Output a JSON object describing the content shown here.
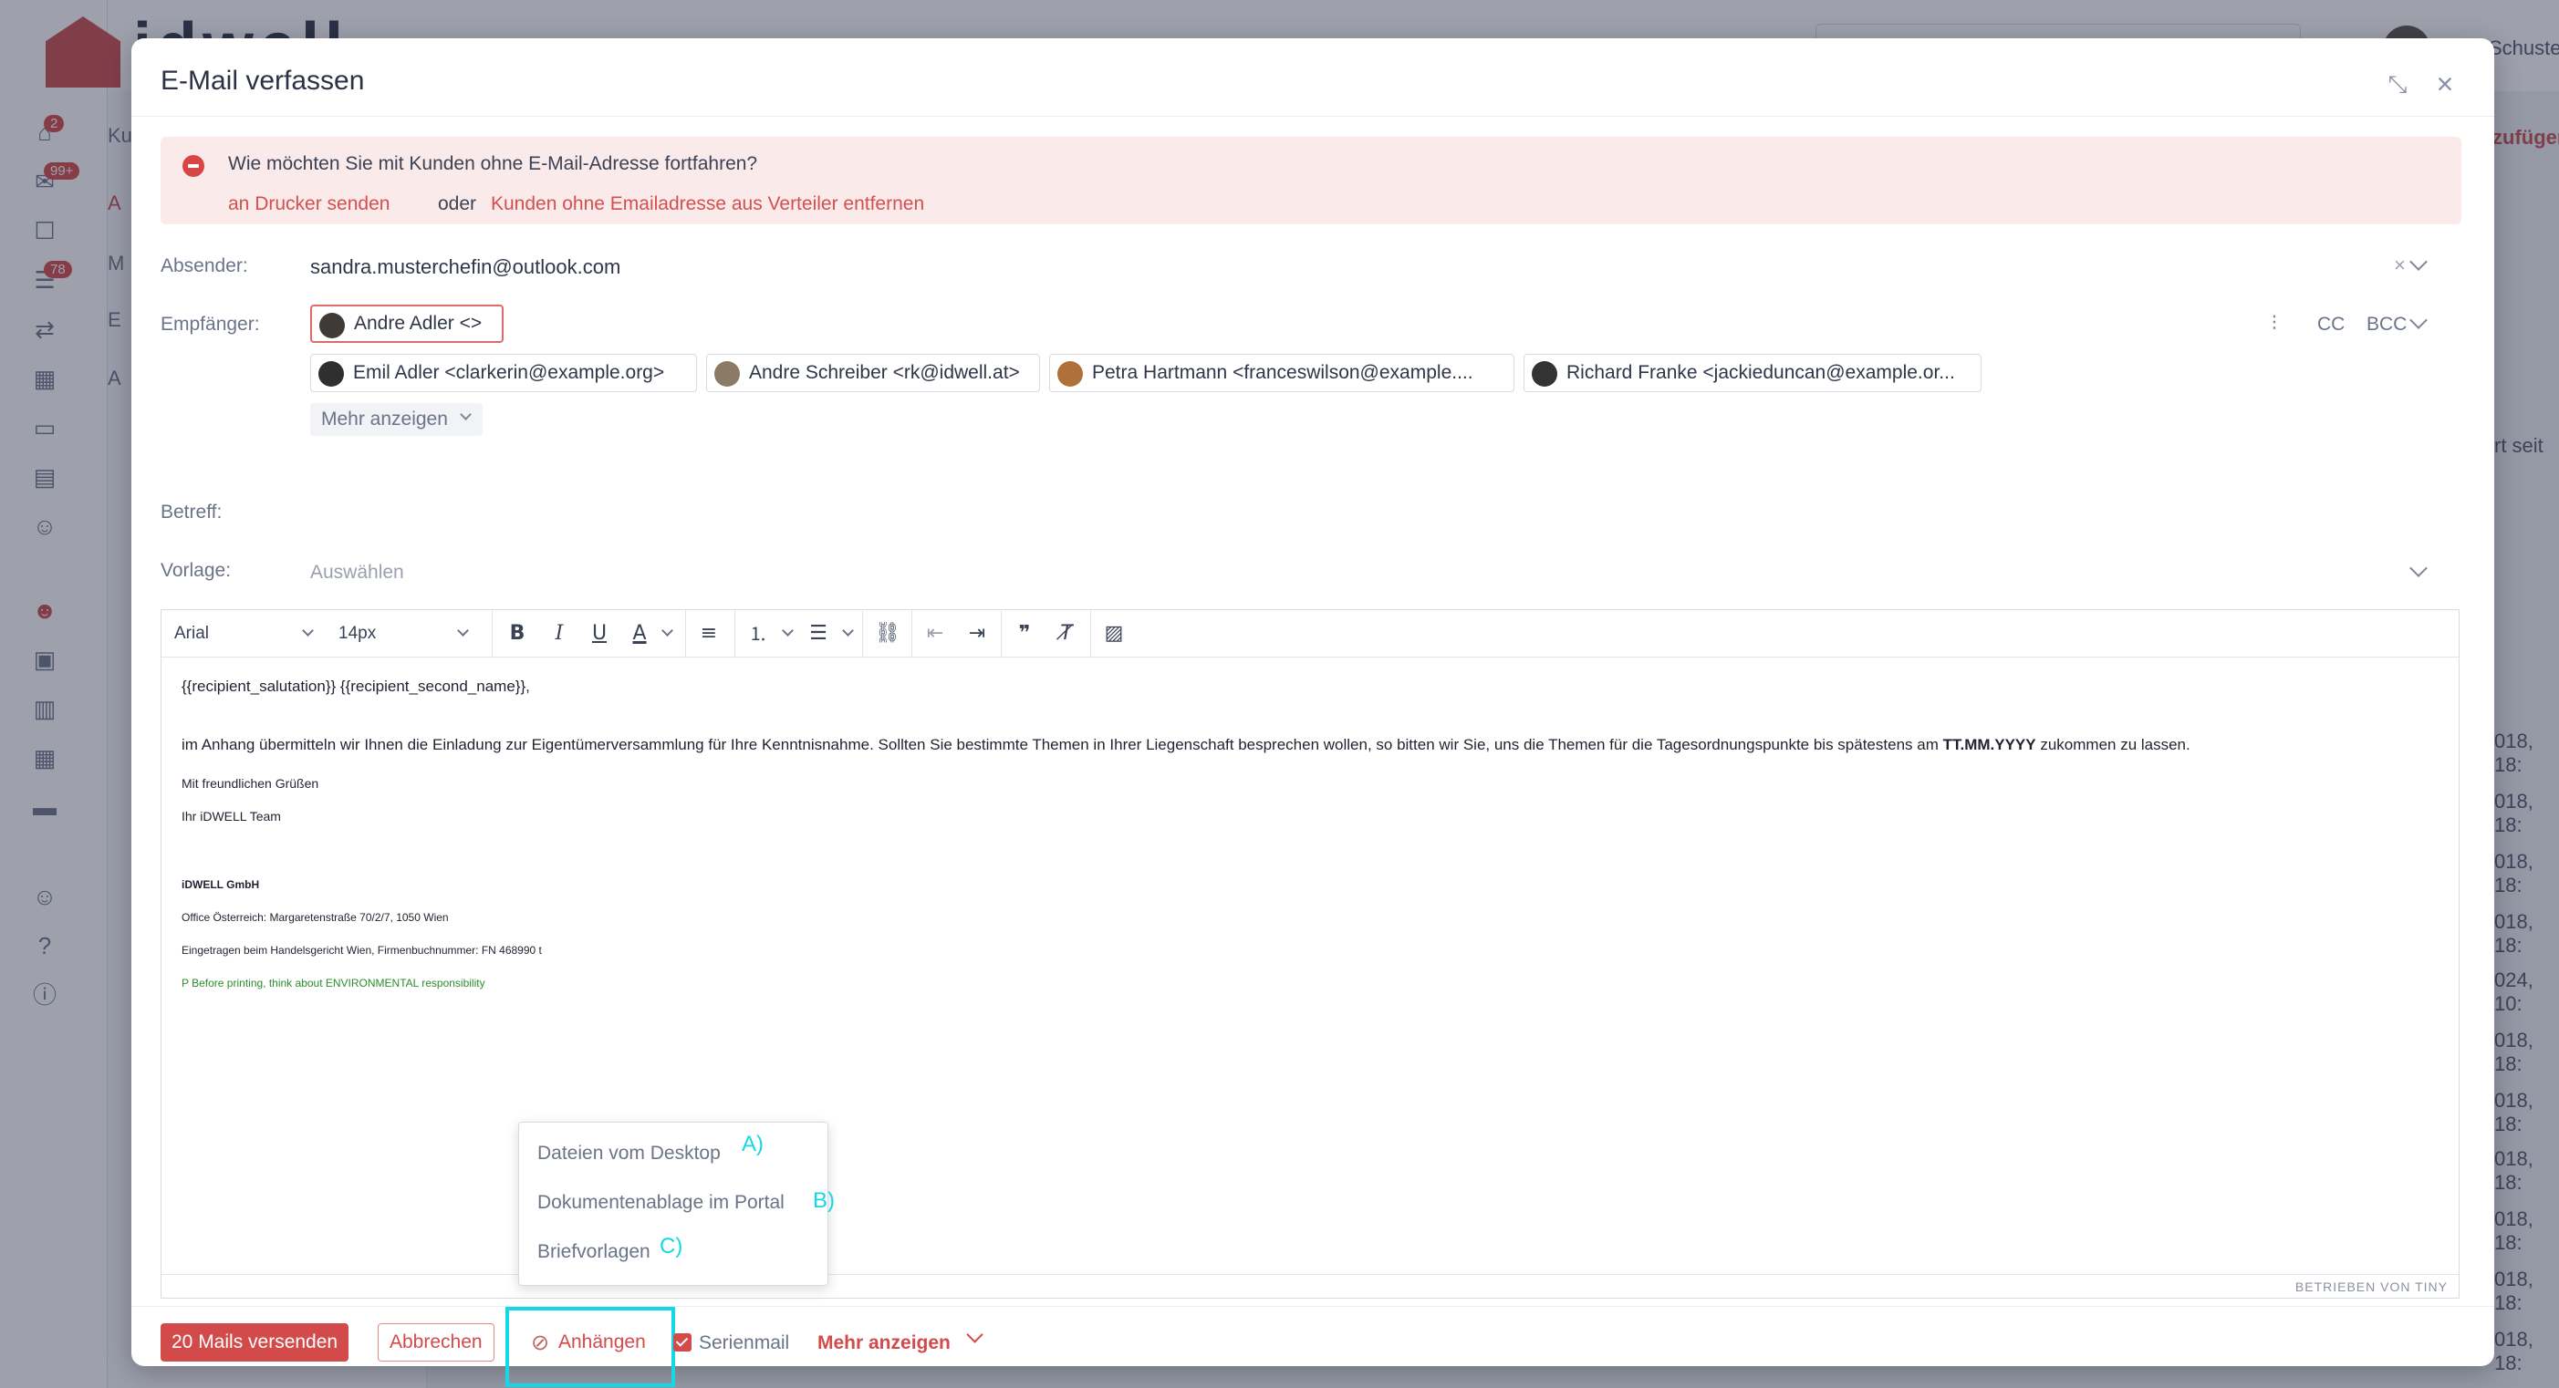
{
  "background": {
    "logo_text": "idwell",
    "nav_badges": [
      "2",
      "99+",
      "78"
    ],
    "subnav_letters": [
      "Ku",
      "A",
      "M",
      "E",
      "A"
    ],
    "username": "Schuster",
    "add_button": "zufügen",
    "table_label": "rt seit",
    "row_dates": [
      "018, 18:",
      "018, 18:",
      "018, 18:",
      "018, 18:",
      "024, 10:",
      "018, 18:",
      "018, 18:",
      "018, 18:",
      "018, 18:",
      "018, 18:",
      "018, 18:"
    ]
  },
  "modal": {
    "title": "E-Mail verfassen",
    "icons": {
      "minimize": "collapse-icon",
      "close": "close-icon"
    }
  },
  "alert": {
    "icon": "minus-circle-icon",
    "message": "Wie möchten Sie mit Kunden ohne E-Mail-Adresse fortfahren?",
    "link_print": "an Drucker senden",
    "or_text": "oder",
    "link_remove": "Kunden ohne Emailadresse aus Verteiler entfernen",
    "color": "#d35050"
  },
  "sender": {
    "label": "Absender:",
    "value": "sandra.musterchefin@outlook.com"
  },
  "recipients": {
    "label": "Empfänger:",
    "chips": [
      {
        "text": "Andre Adler <>",
        "warning": true
      },
      {
        "text": "Emil Adler <clarkerin@example.org>",
        "warning": false
      },
      {
        "text": "Andre Schreiber <rk@idwell.at>",
        "warning": false
      },
      {
        "text": "Petra Hartmann <franceswilson@example....",
        "warning": false
      },
      {
        "text": "Richard Franke <jackieduncan@example.or...",
        "warning": false
      }
    ],
    "cc": "CC",
    "bcc": "BCC",
    "more": "Mehr anzeigen"
  },
  "subject": {
    "label": "Betreff:",
    "value": ""
  },
  "template": {
    "label": "Vorlage:",
    "placeholder": "Auswählen"
  },
  "editor": {
    "font_family": "Arial",
    "font_size": "14px",
    "toolbar_icons": [
      "bold-icon",
      "italic-icon",
      "underline-icon",
      "text-color-icon",
      "align-left-icon",
      "numbered-list-icon",
      "bullet-list-icon",
      "link-icon",
      "outdent-icon",
      "indent-icon",
      "blockquote-icon",
      "clear-format-icon",
      "image-icon"
    ],
    "body": {
      "greeting": "{{recipient_salutation}} {{recipient_second_name}},",
      "paragraph_start": "im Anhang übermitteln wir Ihnen die Einladung zur Eigentümerversammlung für Ihre Kenntnisnahme. Sollten Sie bestimmte Themen in Ihrer Liegenschaft besprechen wollen, so bitten wir Sie, uns die Themen für die Tagesordnungspunkte bis spätestens am ",
      "paragraph_bold": "TT.MM.YYYY",
      "paragraph_end": " zukommen zu lassen.",
      "closing": "Mit freundlichen Grüßen",
      "team": "Ihr iDWELL Team",
      "company": "iDWELL GmbH",
      "office": "Office Österreich: Margaretenstraße 70/2/7, 1050 Wien",
      "registry": "Eingetragen beim Handelsgericht Wien, Firmenbuchnummer: FN 468990 t",
      "eco_note": "P Before printing, think about ENVIRONMENTAL responsibility",
      "eco_color": "#2e8b2e"
    },
    "powered_by": "BETRIEBEN VON TINY"
  },
  "footer": {
    "send": "20 Mails versenden",
    "cancel": "Abbrechen",
    "attach": "Anhängen",
    "serial_label": "Serienmail",
    "serial_checked": true,
    "more": "Mehr anzeigen",
    "accent": "#d34a4a"
  },
  "attach_menu": {
    "items": [
      {
        "label": "Dateien vom Desktop",
        "mark": "A)"
      },
      {
        "label": "Dokumentenablage im Portal",
        "mark": "B)"
      },
      {
        "label": "Briefvorlagen",
        "mark": "C)"
      }
    ],
    "highlight_color": "#14d8e6"
  }
}
